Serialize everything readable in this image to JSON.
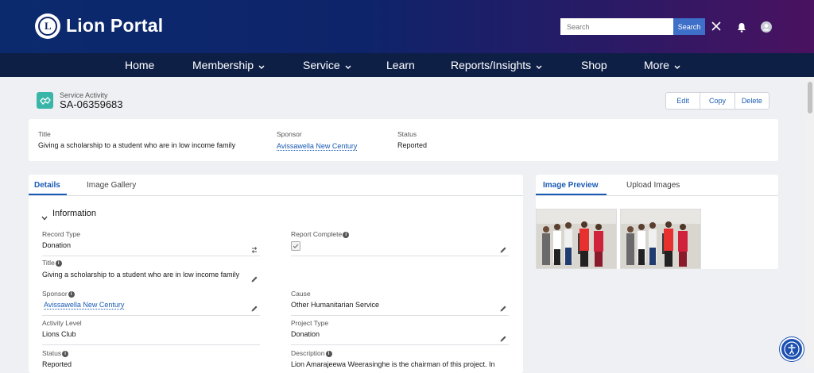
{
  "header": {
    "brand": "Lion Portal",
    "search_placeholder": "Search",
    "search_button": "Search"
  },
  "nav": [
    {
      "label": "Home"
    },
    {
      "label": "Membership"
    },
    {
      "label": "Service"
    },
    {
      "label": "Learn"
    },
    {
      "label": "Reports/Insights"
    },
    {
      "label": "Shop"
    },
    {
      "label": "More"
    }
  ],
  "record": {
    "type_label": "Service Activity",
    "id": "SA-06359683",
    "actions": {
      "edit": "Edit",
      "copy": "Copy",
      "delete": "Delete"
    }
  },
  "highlights": {
    "title_label": "Title",
    "title_value": "Giving a scholarship to a student who are in low income family",
    "sponsor_label": "Sponsor",
    "sponsor_value": "Avissawella New Century",
    "status_label": "Status",
    "status_value": "Reported"
  },
  "tabs": {
    "details": "Details",
    "gallery": "Image Gallery"
  },
  "section": {
    "title": "Information"
  },
  "fields": {
    "record_type_label": "Record Type",
    "record_type_value": "Donation",
    "report_complete_label": "Report Complete",
    "title_label": "Title",
    "title_value": "Giving a scholarship to a student who are in low income family",
    "sponsor_label": "Sponsor",
    "sponsor_value": "Avissawella New Century",
    "cause_label": "Cause",
    "cause_value": "Other Humanitarian Service",
    "activity_level_label": "Activity Level",
    "activity_level_value": "Lions Club",
    "project_type_label": "Project Type",
    "project_type_value": "Donation",
    "status_label": "Status",
    "status_value": "Reported",
    "description_label": "Description",
    "description_value": "Lion Amarajeewa Weerasinghe is the chairman of this project. In"
  },
  "right_tabs": {
    "preview": "Image Preview",
    "upload": "Upload Images"
  },
  "colors": {
    "accent": "#1a5bb5",
    "record_icon": "#3ab6a8",
    "nav_bg": "#0e1f46"
  }
}
